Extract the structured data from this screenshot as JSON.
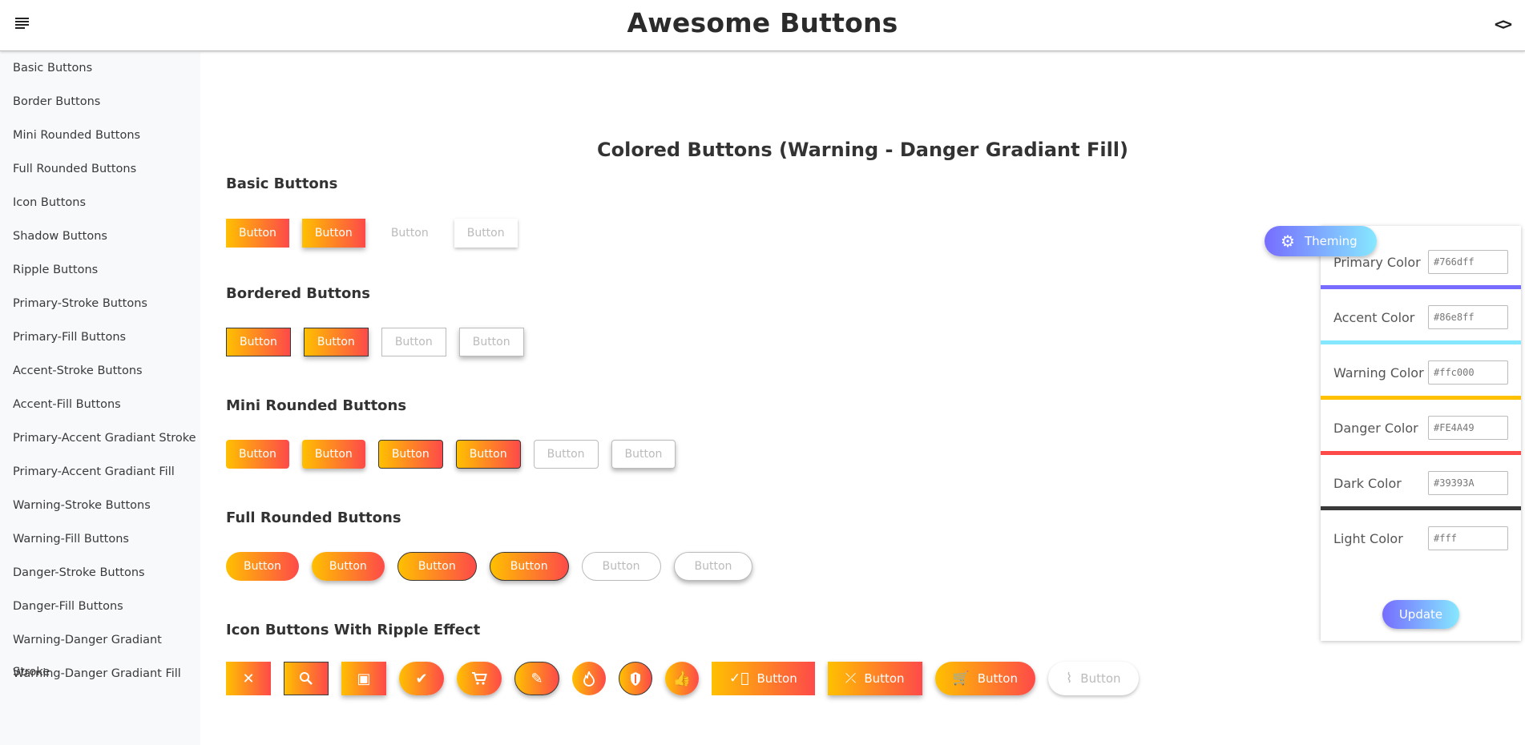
{
  "header": {
    "title": "Awesome Buttons",
    "code_icon": "code-icon",
    "menu_icon": "menu-icon"
  },
  "sidebar": {
    "items": [
      {
        "label": "Basic Buttons"
      },
      {
        "label": "Border Buttons"
      },
      {
        "label": "Mini Rounded Buttons"
      },
      {
        "label": "Full Rounded Buttons"
      },
      {
        "label": "Icon Buttons"
      },
      {
        "label": "Shadow Buttons"
      },
      {
        "label": "Ripple Buttons"
      },
      {
        "label": "Primary-Stroke Buttons"
      },
      {
        "label": "Primary-Fill Buttons"
      },
      {
        "label": "Accent-Stroke Buttons"
      },
      {
        "label": "Accent-Fill Buttons"
      },
      {
        "label": "Primary-Accent Gradiant Stroke"
      },
      {
        "label": "Primary-Accent Gradiant Fill"
      },
      {
        "label": "Warning-Stroke Buttons"
      },
      {
        "label": "Warning-Fill Buttons"
      },
      {
        "label": "Danger-Stroke Buttons"
      },
      {
        "label": "Danger-Fill Buttons"
      },
      {
        "label": "Warning-Danger Gradiant Stroke"
      },
      {
        "label": "Warning-Danger Gradiant Fill"
      }
    ]
  },
  "main": {
    "heading": "Colored Buttons (Warning - Danger Gradiant Fill)",
    "button_label": "Button",
    "sections": {
      "basic": "Basic Buttons",
      "bordered": "Bordered Buttons",
      "mini_rounded": "Mini Rounded Buttons",
      "full_rounded": "Full Rounded Buttons",
      "icon_ripple": "Icon Buttons With Ripple Effect"
    },
    "icons": [
      "cutlery-icon",
      "search-icon",
      "add-photo-icon",
      "double-check-icon",
      "cart-icon",
      "pencil-icon",
      "fire-icon",
      "shield-icon",
      "thumbs-up-icon",
      "check-circle-icon",
      "call-missed-icon",
      "add-cart-icon",
      "wifi-off-icon"
    ]
  },
  "theming": {
    "toggle_label": "Theming",
    "toggle_icon": "gear-icon",
    "colors": [
      {
        "label": "Primary Color",
        "value": "#766dff",
        "bar": "#766dff"
      },
      {
        "label": "Accent Color",
        "value": "#86e8ff",
        "bar": "#86e8ff"
      },
      {
        "label": "Warning Color",
        "value": "#ffc000",
        "bar": "#ffc000"
      },
      {
        "label": "Danger Color",
        "value": "#FE4A49",
        "bar": "#FE4A49"
      },
      {
        "label": "Dark Color",
        "value": "#39393A",
        "bar": "#39393A"
      },
      {
        "label": "Light Color",
        "value": "#fff",
        "bar": "#ffffff"
      }
    ],
    "update_label": "Update"
  }
}
